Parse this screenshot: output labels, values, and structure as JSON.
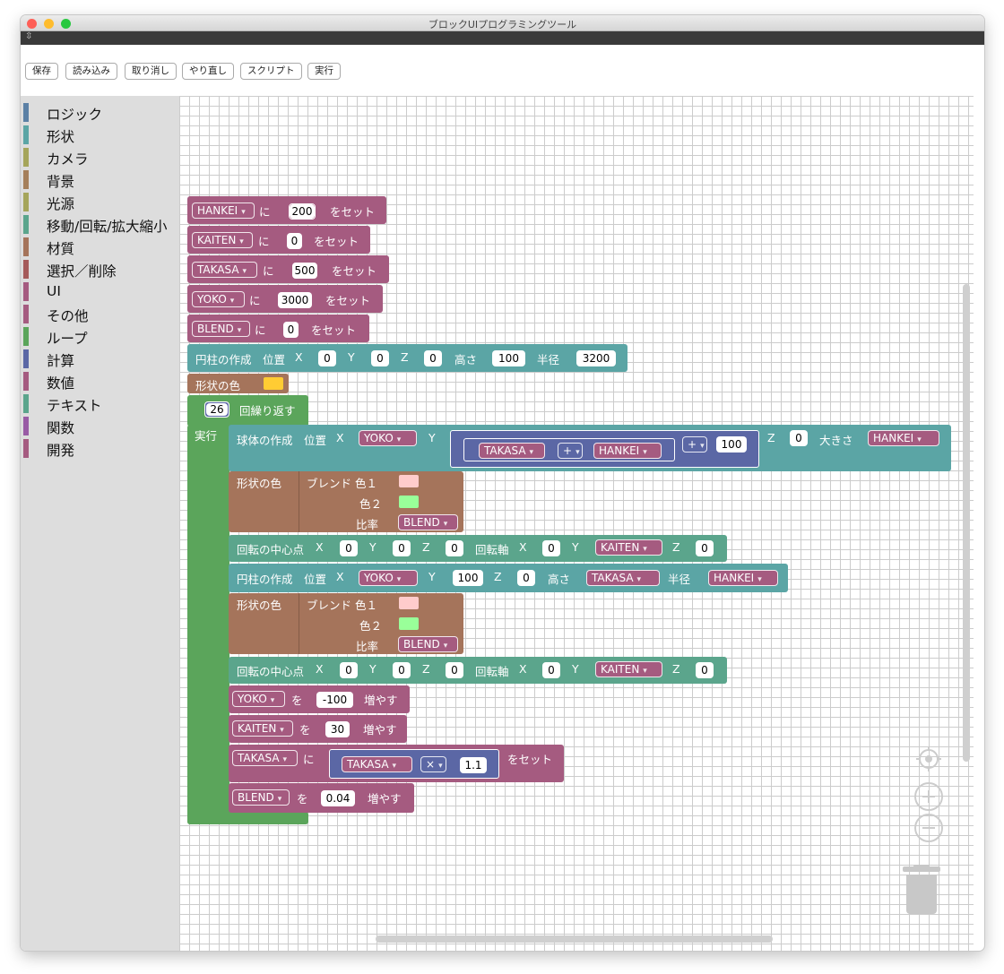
{
  "window": {
    "title": "ブロックUIプログラミングツール",
    "dark_glyph": "⇳"
  },
  "toolbar": {
    "save": "保存",
    "load": "読み込み",
    "undo": "取り消し",
    "redo": "やり直し",
    "script": "スクリプト",
    "run": "実行"
  },
  "categories": [
    {
      "label": "ロジック",
      "color": "#5b80a5"
    },
    {
      "label": "形状",
      "color": "#5ba5a5"
    },
    {
      "label": "カメラ",
      "color": "#a5a55b"
    },
    {
      "label": "背景",
      "color": "#a57f5b"
    },
    {
      "label": "光源",
      "color": "#a5a55b"
    },
    {
      "label": "移動/回転/拡大縮小",
      "color": "#5ba58c"
    },
    {
      "label": "材質",
      "color": "#a5745b"
    },
    {
      "label": "選択／削除",
      "color": "#a55b5b"
    },
    {
      "label": "UI",
      "color": "#a55b80"
    },
    {
      "label": "その他",
      "color": "#a55b80"
    },
    {
      "label": "ループ",
      "color": "#5ba55b"
    },
    {
      "label": "計算",
      "color": "#5b67a5"
    },
    {
      "label": "数値",
      "color": "#a55b80"
    },
    {
      "label": "テキスト",
      "color": "#5ba58c"
    },
    {
      "label": "関数",
      "color": "#995ba5"
    },
    {
      "label": "開発",
      "color": "#a55b80"
    }
  ],
  "colors": {
    "var": "#a55b80",
    "shape": "#5ba5a5",
    "loop": "#5ba55b",
    "material": "#a5745b",
    "transform": "#5ba58c",
    "math": "#5b67a5",
    "swatch_yellow": "#ffcc33",
    "swatch_pink": "#ffcccc",
    "swatch_green": "#99ff99"
  },
  "blocks": {
    "set1": {
      "var": "HANKEI",
      "ni": "に",
      "val": "200",
      "set": "をセット"
    },
    "set2": {
      "var": "KAITEN",
      "ni": "に",
      "val": "0",
      "set": "をセット"
    },
    "set3": {
      "var": "TAKASA",
      "ni": "に",
      "val": "500",
      "set": "をセット"
    },
    "set4": {
      "var": "YOKO",
      "ni": "に",
      "val": "3000",
      "set": "をセット"
    },
    "set5": {
      "var": "BLEND",
      "ni": "に",
      "val": "0",
      "set": "をセット"
    },
    "cyl1": {
      "label": "円柱の作成",
      "pos": "位置",
      "x": "X",
      "xv": "0",
      "y": "Y",
      "yv": "0",
      "z": "Z",
      "zv": "0",
      "h": "高さ",
      "hv": "100",
      "r": "半径",
      "rv": "3200"
    },
    "color1": {
      "label": "形状の色"
    },
    "loop": {
      "count": "26",
      "label": "回繰り返す",
      "do": "実行"
    },
    "sphere": {
      "label": "球体の作成",
      "pos": "位置",
      "x": "X",
      "xvar": "YOKO",
      "y": "Y",
      "a": "TAKASA",
      "op1": "+",
      "b": "HANKEI",
      "op2": "+",
      "c": "100",
      "z": "Z",
      "zv": "0",
      "size": "大きさ",
      "sizevar": "HANKEI"
    },
    "blend1": {
      "label": "形状の色",
      "blend": "ブレンド 色１",
      "c2": "色２",
      "ratio": "比率",
      "rvar": "BLEND"
    },
    "rot1": {
      "label": "回転の中心点",
      "x": "X",
      "xv": "0",
      "y": "Y",
      "yv": "0",
      "z": "Z",
      "zv": "0",
      "axis": "回転軸",
      "ax": "X",
      "axv": "0",
      "ay": "Y",
      "ayvar": "KAITEN",
      "az": "Z",
      "azv": "0"
    },
    "cyl2": {
      "label": "円柱の作成",
      "pos": "位置",
      "x": "X",
      "xvar": "YOKO",
      "y": "Y",
      "yv": "100",
      "z": "Z",
      "zv": "0",
      "h": "高さ",
      "hvar": "TAKASA",
      "r": "半径",
      "rvar": "HANKEI"
    },
    "blend2": {
      "label": "形状の色",
      "blend": "ブレンド 色１",
      "c2": "色２",
      "ratio": "比率",
      "rvar": "BLEND"
    },
    "rot2": {
      "label": "回転の中心点",
      "x": "X",
      "xv": "0",
      "y": "Y",
      "yv": "0",
      "z": "Z",
      "zv": "0",
      "axis": "回転軸",
      "ax": "X",
      "axv": "0",
      "ay": "Y",
      "ayvar": "KAITEN",
      "az": "Z",
      "azv": "0"
    },
    "inc1": {
      "var": "YOKO",
      "wo": "を",
      "val": "-100",
      "inc": "増やす"
    },
    "inc2": {
      "var": "KAITEN",
      "wo": "を",
      "val": "30",
      "inc": "増やす"
    },
    "set6": {
      "var": "TAKASA",
      "ni": "に",
      "a": "TAKASA",
      "op": "×",
      "b": "1.1",
      "set": "をセット"
    },
    "inc3": {
      "var": "BLEND",
      "wo": "を",
      "val": "0.04",
      "inc": "増やす"
    }
  },
  "controls": {
    "center": "⊕",
    "zoom_in": "+",
    "zoom_out": "−"
  }
}
